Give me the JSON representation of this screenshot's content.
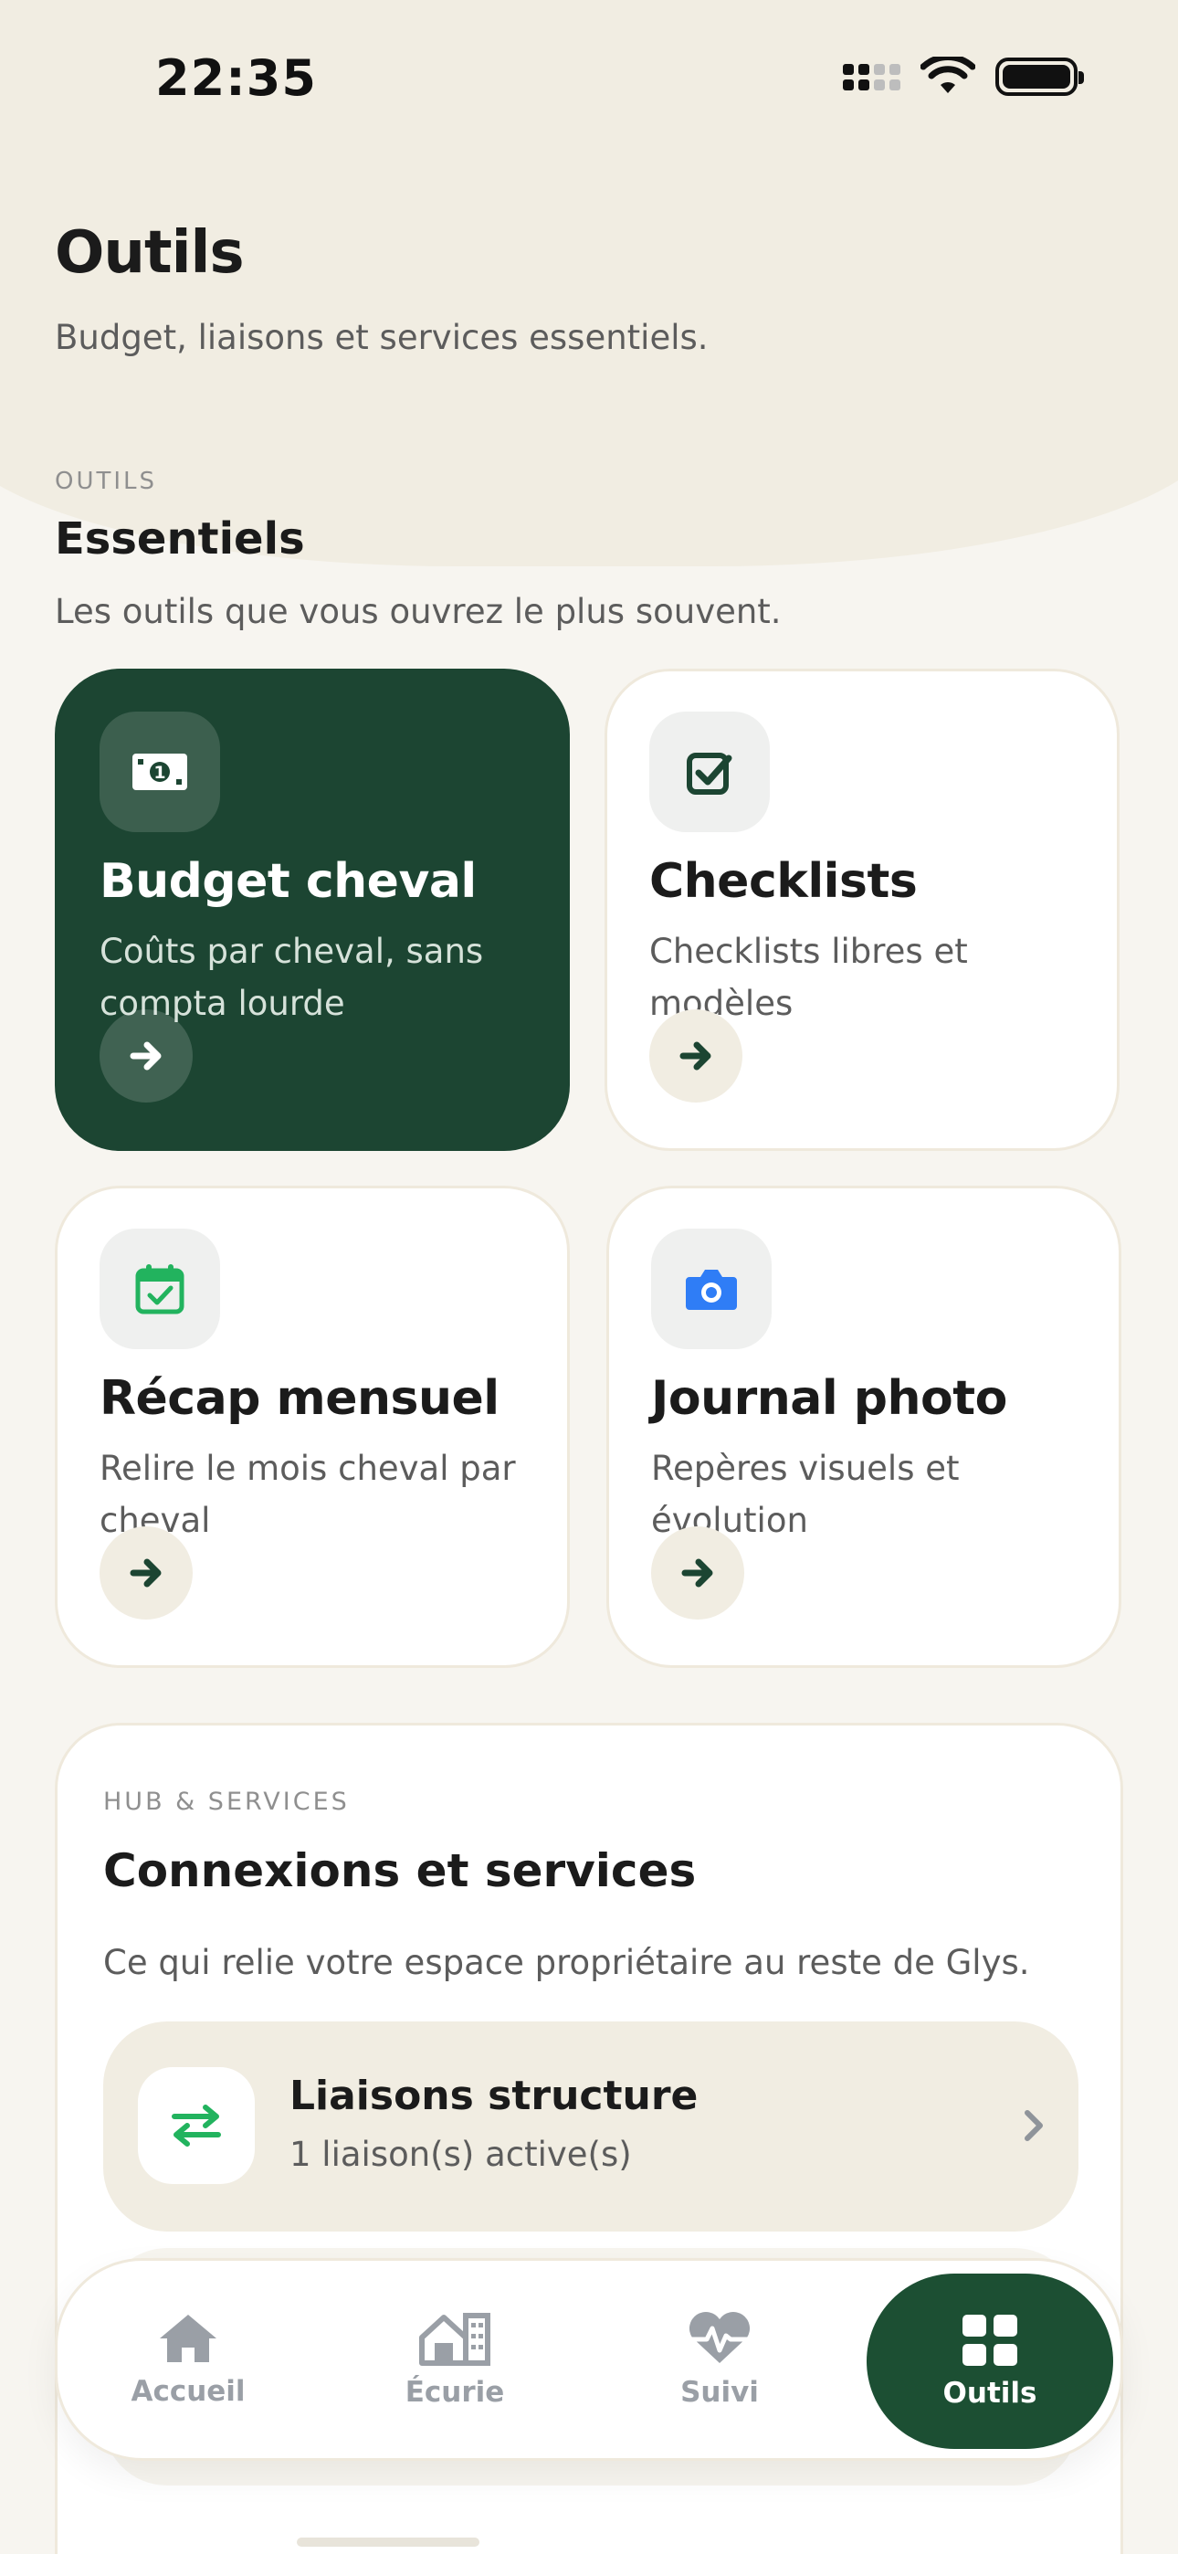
{
  "status_bar": {
    "time": "22:35"
  },
  "header": {
    "title": "Outils",
    "subtitle": "Budget, liaisons et services essentiels."
  },
  "essentials": {
    "eyebrow": "OUTILS",
    "title": "Essentiels",
    "description": "Les outils que vous ouvrez le plus souvent.",
    "cards": [
      {
        "title": "Budget cheval",
        "description": "Coûts par cheval, sans compta lourde",
        "icon": "money-icon"
      },
      {
        "title": "Checklists",
        "description": "Checklists libres et modèles",
        "icon": "checkbox-icon"
      },
      {
        "title": "Récap mensuel",
        "description": "Relire le mois cheval par cheval",
        "icon": "calendar-check-icon"
      },
      {
        "title": "Journal photo",
        "description": "Repères visuels et évolution",
        "icon": "camera-icon"
      }
    ]
  },
  "hub": {
    "eyebrow": "HUB & SERVICES",
    "title": "Connexions et services",
    "description": "Ce qui relie votre espace propriétaire au reste de Glys.",
    "items": [
      {
        "title": "Liaisons structure",
        "subtitle": "1 liaison(s) active(s)",
        "icon": "swap-arrows-icon"
      }
    ]
  },
  "tab_bar": {
    "tabs": [
      {
        "label": "Accueil",
        "icon": "home-icon",
        "active": false
      },
      {
        "label": "Écurie",
        "icon": "stable-icon",
        "active": false
      },
      {
        "label": "Suivi",
        "icon": "heart-pulse-icon",
        "active": false
      },
      {
        "label": "Outils",
        "icon": "grid-icon",
        "active": true
      }
    ]
  },
  "colors": {
    "primary_dark_green": "#1c4532",
    "active_tab_green": "#1c4f33",
    "accent_green": "#22b35e",
    "accent_blue": "#2f7df6",
    "cream": "#f1ede2",
    "muted_text": "#5c5c5c"
  }
}
